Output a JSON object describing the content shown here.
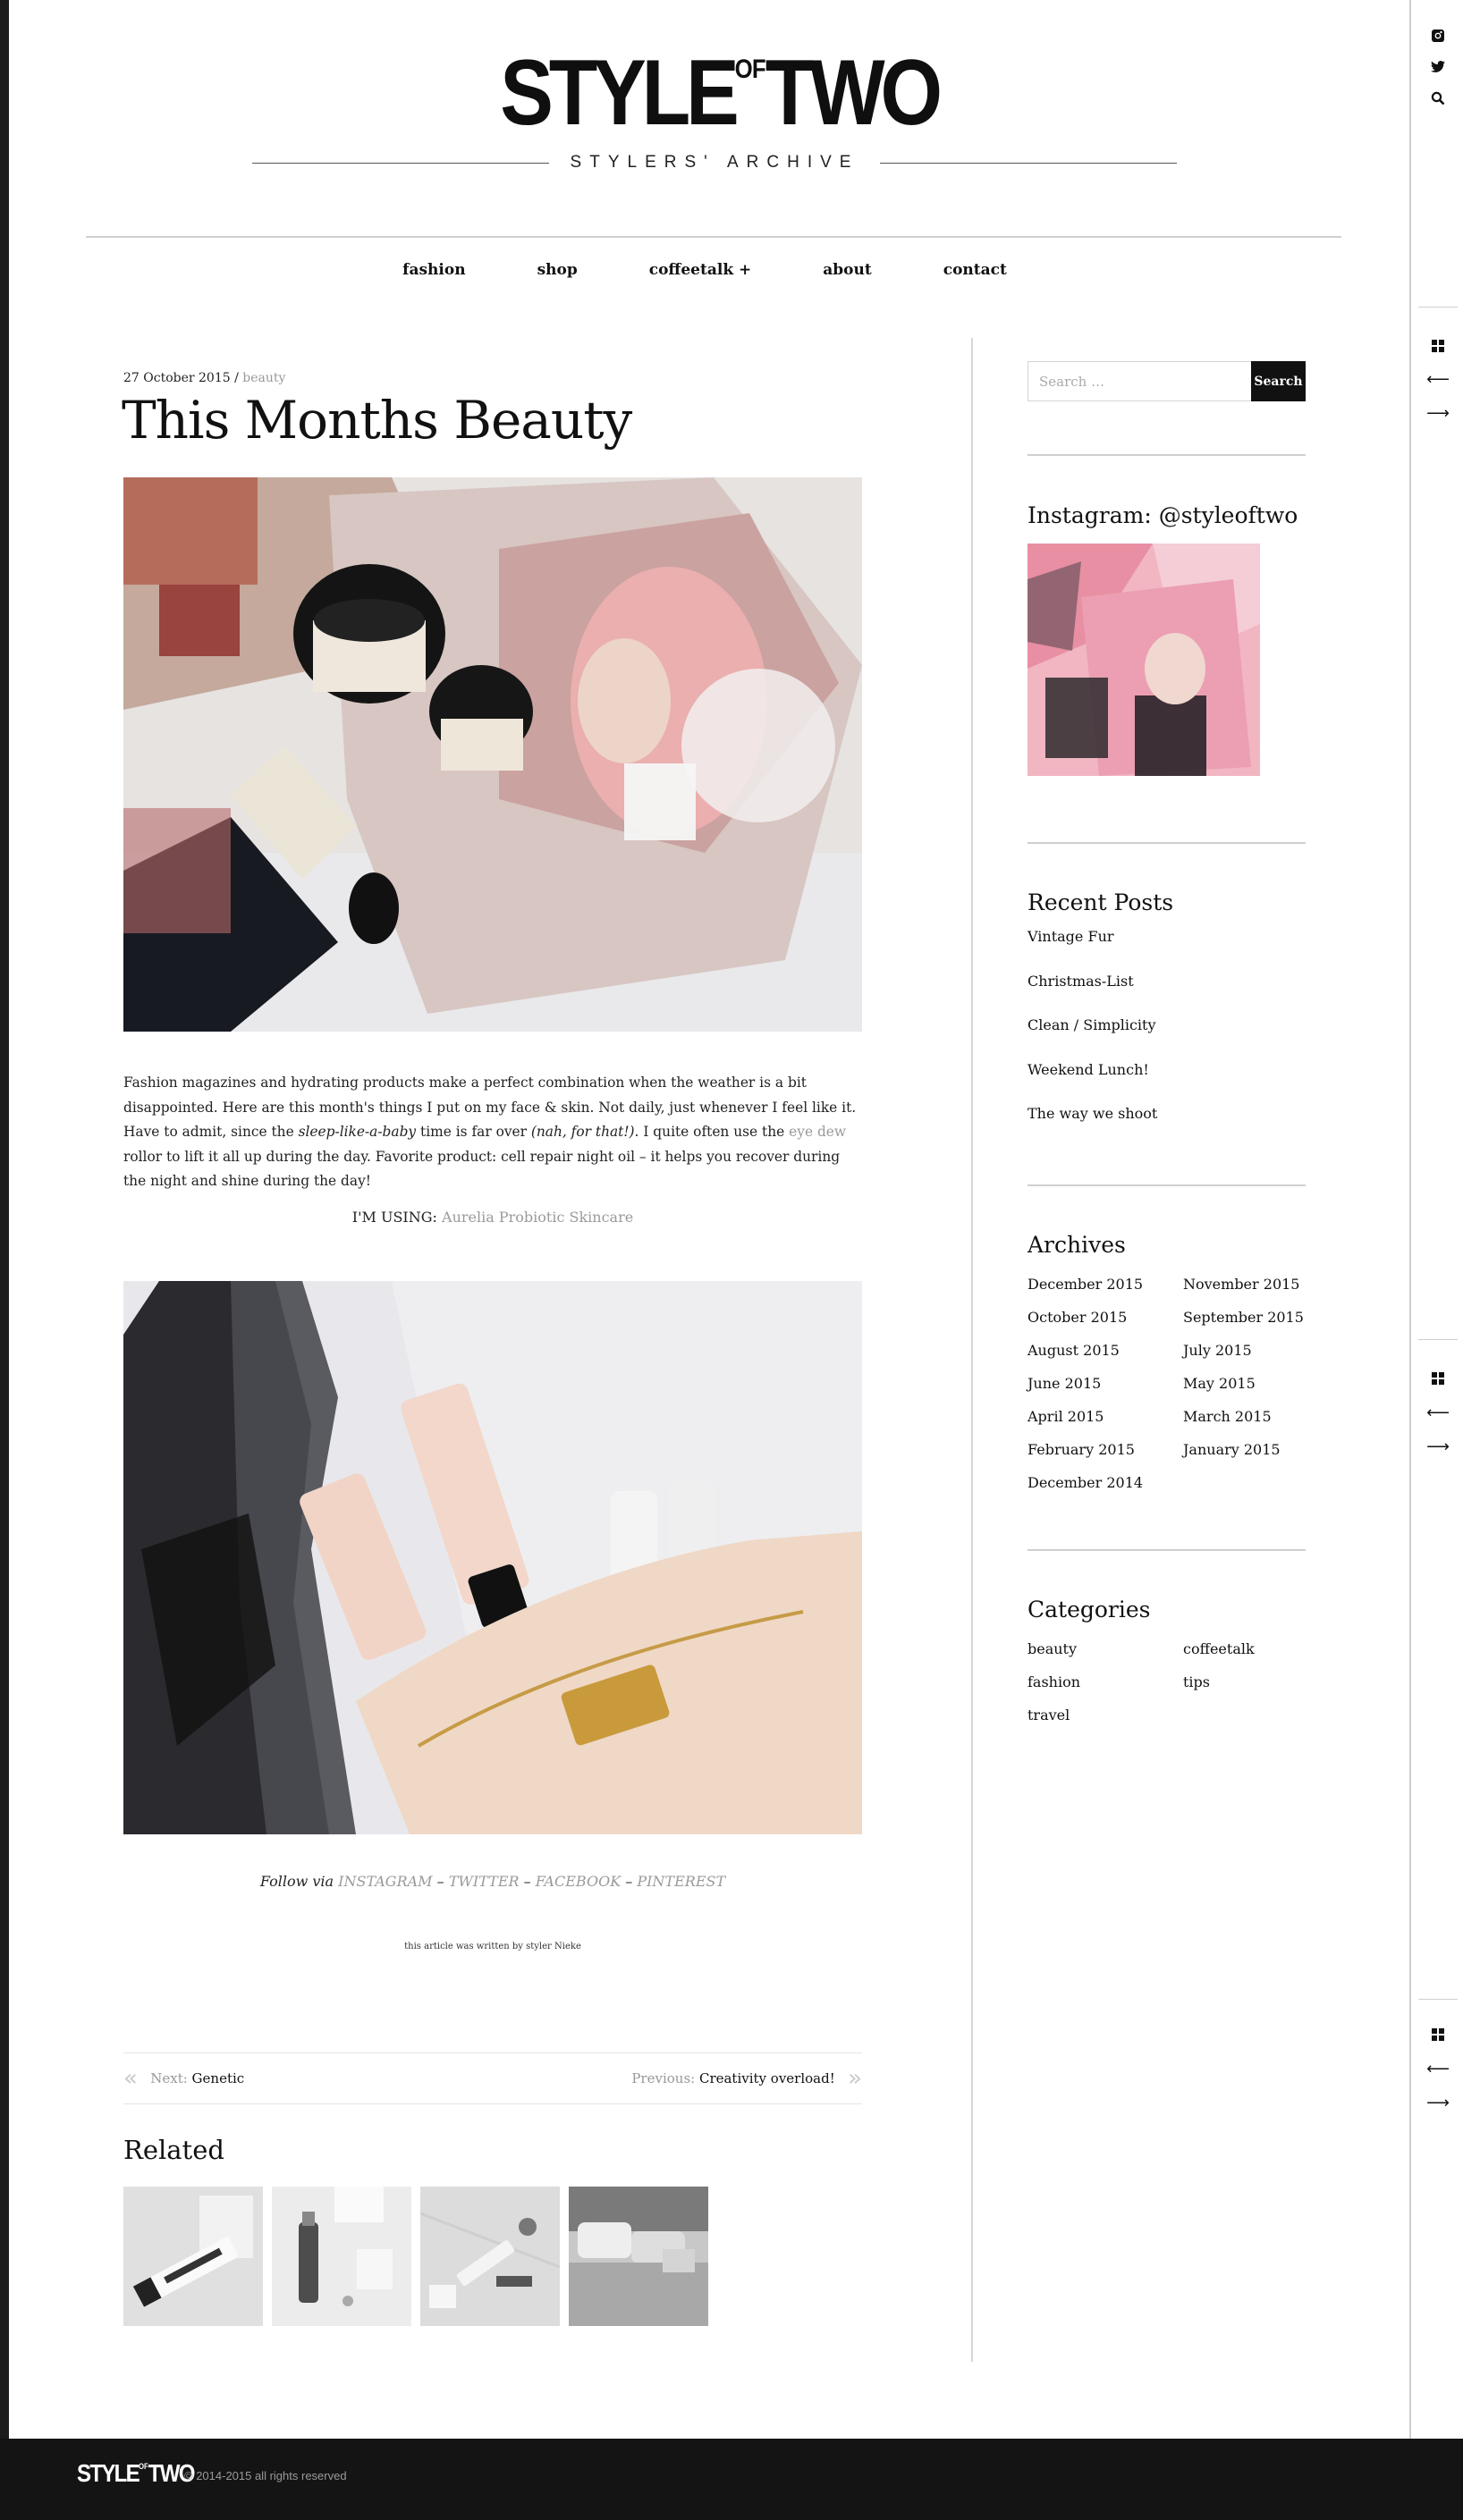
{
  "site": {
    "logo_main": "STYLE",
    "logo_of": "OF",
    "logo_two": "TWO",
    "tagline": "STYLERS' ARCHIVE"
  },
  "nav": [
    "fashion",
    "shop",
    "coffeetalk +",
    "about",
    "contact"
  ],
  "post": {
    "date": "27 October 2015",
    "separator": " / ",
    "category": "beauty",
    "title": "This Months Beauty",
    "body_1": "Fashion magazines and hydrating products make a perfect combination when the weather is a bit disappointed. Here are this month's things I put on my face & skin. Not daily, just whenever I feel like it. Have to admit, since the ",
    "body_em1": "sleep-like-a-baby",
    "body_2": " time is far over ",
    "body_em2": "(nah, for that!)",
    "body_3": ". I quite often use the ",
    "body_link": "eye dew",
    "body_4": " rollor to lift it all up during the day. Favorite product: cell repair night oil – it helps you recover during the night and shine during the day!",
    "using_label": "I'M USING: ",
    "using_link": "Aurelia Probiotic Skincare",
    "follow_label": "Follow via ",
    "follow_links": [
      "INSTAGRAM",
      "TWITTER",
      "FACEBOOK",
      "PINTEREST"
    ],
    "follow_sep": " – ",
    "byline": "this article was written by styler Nieke"
  },
  "post_nav": {
    "next_label": "Next: ",
    "next_title": "Genetic",
    "prev_label": "Previous: ",
    "prev_title": "Creativity overload!"
  },
  "related": {
    "heading": "Related"
  },
  "sidebar": {
    "search_placeholder": "Search …",
    "search_button": "Search",
    "instagram_heading": "Instagram: @styleoftwo",
    "recent_heading": "Recent Posts",
    "recent_posts": [
      "Vintage Fur",
      "Christmas-List",
      "Clean / Simplicity",
      "Weekend Lunch!",
      "The way we shoot"
    ],
    "archives_heading": "Archives",
    "archives": [
      "December 2015",
      "November 2015",
      "October 2015",
      "September 2015",
      "August 2015",
      "July 2015",
      "June 2015",
      "May 2015",
      "April 2015",
      "March 2015",
      "February 2015",
      "January 2015",
      "December 2014"
    ],
    "categories_heading": "Categories",
    "categories": [
      "beauty",
      "coffeetalk",
      "fashion",
      "tips",
      "travel"
    ]
  },
  "footer": {
    "logo_main": "STYLE",
    "logo_of": "OF",
    "logo_two": "TWO",
    "copyright": "© 2014-2015 all rights reserved"
  },
  "rail": {
    "icons": [
      "instagram-icon",
      "twitter-icon",
      "search-icon",
      "grid-icon",
      "arrow-left-icon",
      "arrow-right-icon"
    ]
  }
}
